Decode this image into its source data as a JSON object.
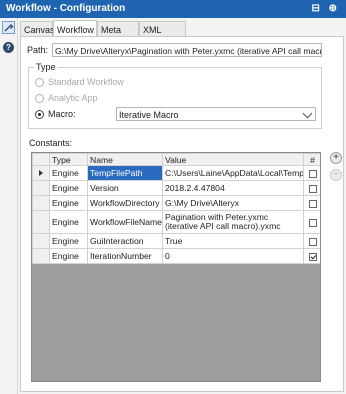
{
  "window": {
    "title": "Workflow - Configuration"
  },
  "tabs": [
    "Canvas",
    "Workflow",
    "Meta Info",
    "XML View"
  ],
  "path": {
    "label": "Path:",
    "value": "G:\\My Drive\\Alteryx\\Pagination with Peter.yxmc (iterative API call macro).yxmc"
  },
  "type_group": {
    "legend": "Type",
    "options": [
      {
        "label": "Standard Workflow",
        "selected": false,
        "enabled": false
      },
      {
        "label": "Analytic App",
        "selected": false,
        "enabled": false
      },
      {
        "label": "Macro:",
        "selected": true,
        "enabled": true
      }
    ],
    "macro_type": "Iterative Macro"
  },
  "constants": {
    "label": "Constants:",
    "columns": [
      "Type",
      "Name",
      "Value",
      "#"
    ],
    "rows": [
      {
        "type": "Engine",
        "name": "TempFilePath",
        "value": "C:\\Users\\Laine\\AppData\\Local\\Temp\\",
        "numeric": false
      },
      {
        "type": "Engine",
        "name": "Version",
        "value": "2018.2.4.47804",
        "numeric": false
      },
      {
        "type": "Engine",
        "name": "WorkflowDirectory",
        "value": "G:\\My Drive\\Alteryx",
        "numeric": false
      },
      {
        "type": "Engine",
        "name": "WorkflowFileName",
        "value": "Pagination with Peter.yxmc (iterative API call macro).yxmc",
        "numeric": false
      },
      {
        "type": "Engine",
        "name": "GuiInteraction",
        "value": "True",
        "numeric": false
      },
      {
        "type": "Engine",
        "name": "IterationNumber",
        "value": "0",
        "numeric": true
      }
    ],
    "add_glyph": "+",
    "remove_glyph": "−"
  },
  "icons": {
    "title_icons": "⊟ ⊕",
    "help": "?"
  }
}
